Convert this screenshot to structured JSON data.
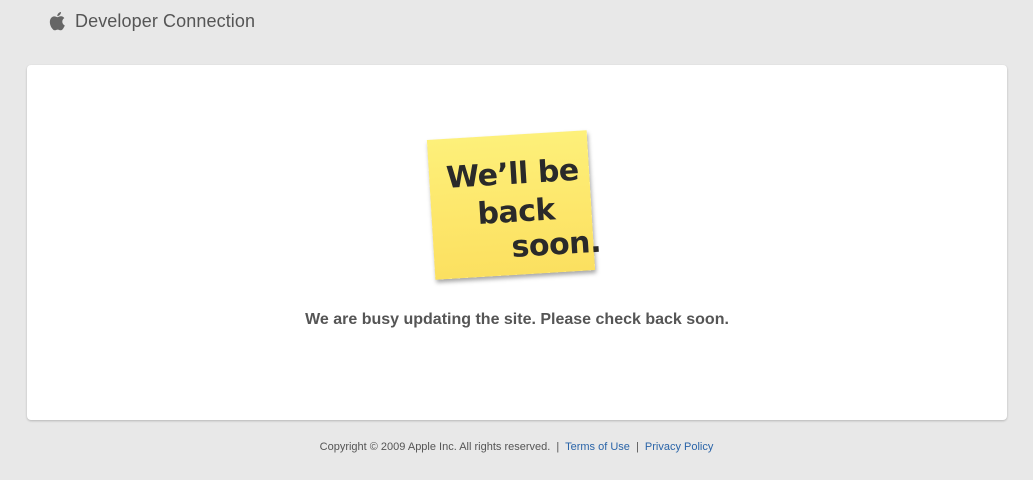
{
  "header": {
    "logo_icon": "apple-logo-icon",
    "title": "Developer Connection"
  },
  "sticky_note": {
    "line1": "We’ll be",
    "line2": "back",
    "line3": "soon.",
    "color": "#fde66a"
  },
  "message": "We are busy updating the site. Please check back soon.",
  "footer": {
    "copyright": "Copyright © 2009 Apple Inc. All rights reserved.",
    "separator": "|",
    "terms_link": "Terms of Use",
    "privacy_link": "Privacy Policy",
    "link_color": "#2a64a8"
  },
  "colors": {
    "background": "#e8e8e8",
    "panel": "#ffffff",
    "text": "#555555"
  }
}
